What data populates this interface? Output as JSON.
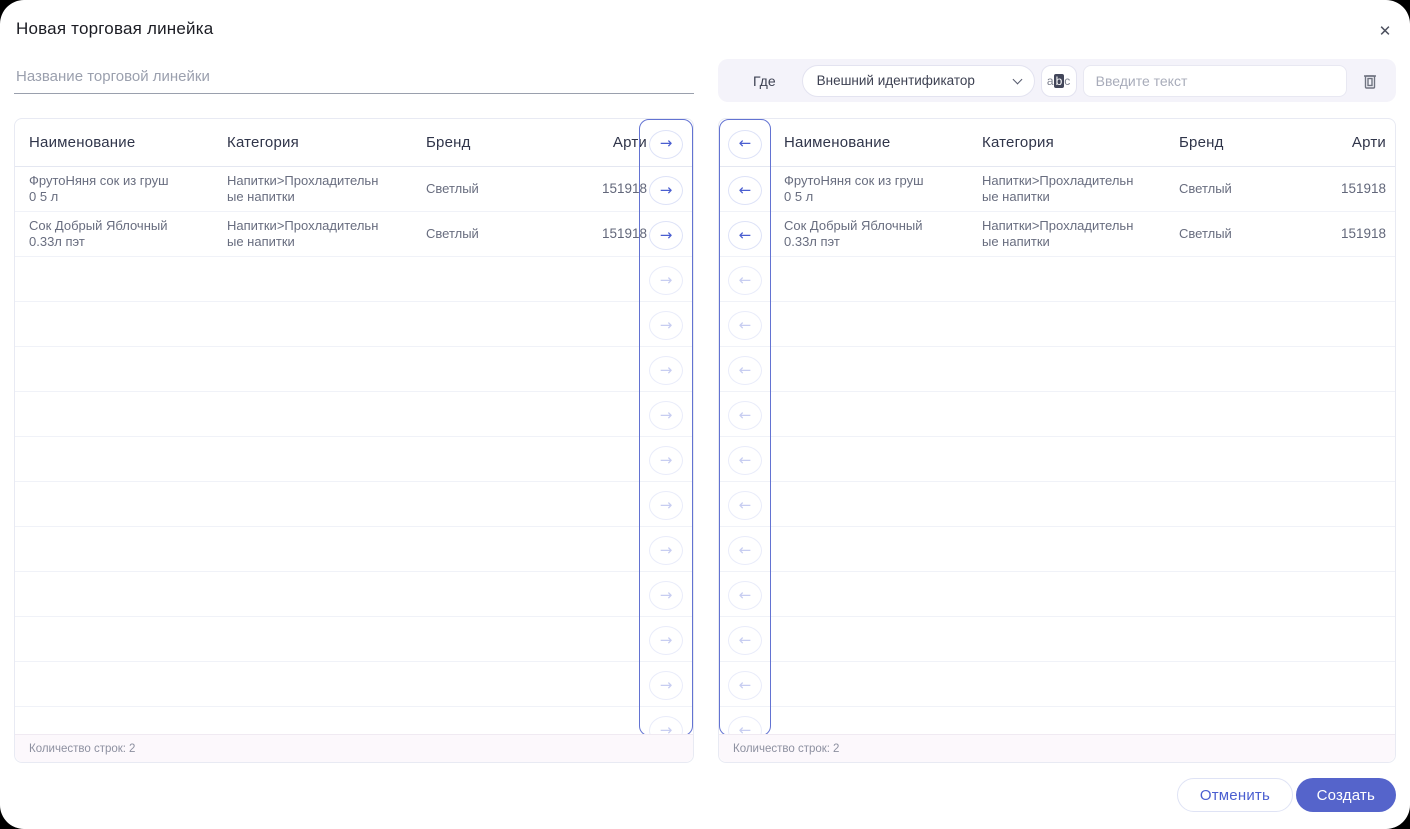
{
  "modal": {
    "title": "Новая торговая линейка",
    "close_glyph": "✕"
  },
  "name_field": {
    "placeholder": "Название торговой линейки"
  },
  "filter": {
    "where_label": "Где",
    "field_select_value": "Внешний идентификатор",
    "match_case_letters": [
      "a",
      "b",
      "c"
    ],
    "text_placeholder": "Введите текст"
  },
  "table": {
    "columns": [
      "Наименование",
      "Категория",
      "Бренд",
      "Арти"
    ],
    "rows": [
      {
        "name": "ФрутоНяня сок из груш 0 5 л",
        "category": "Напитки>Прохладительные напитки",
        "brand": "Светлый",
        "article": "151918"
      },
      {
        "name": "Сок Добрый Яблочный 0.33л пэт",
        "category": "Напитки>Прохладительные напитки",
        "brand": "Светлый",
        "article": "151918"
      }
    ],
    "total_visible_rows": 13,
    "footer_label": "Количество строк:",
    "row_count": "2"
  },
  "icons": {
    "arrow_right": "→",
    "arrow_left": "←",
    "trash": "trash-icon",
    "chevron_down": "chevron-down-icon",
    "match_case": "match-case-icon"
  },
  "actions": {
    "cancel": "Отменить",
    "create": "Создать"
  },
  "colors": {
    "accent": "#5564cb",
    "arrow_active": "#4a5ed0",
    "arrow_column_border": "#6373d2",
    "filter_bar_bg": "#f4f3fa",
    "table_footer_bg": "#fcf8fc",
    "page_bg": "#000000"
  }
}
